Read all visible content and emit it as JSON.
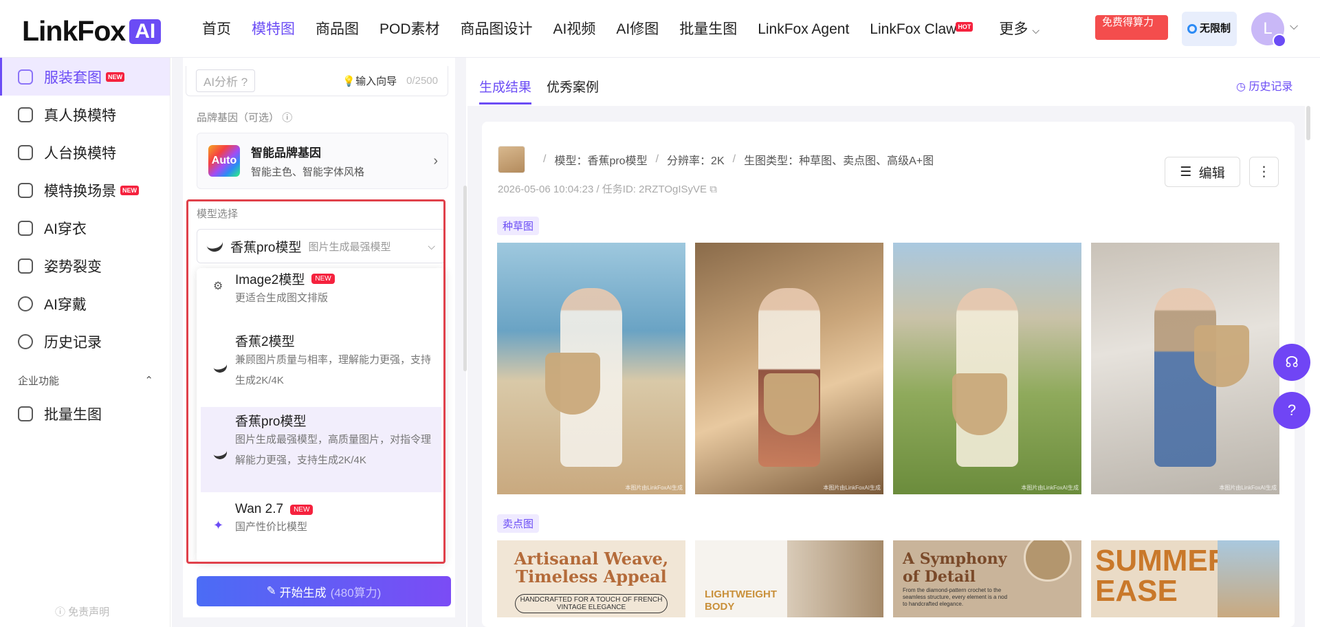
{
  "logo": {
    "text": "LinkFox",
    "badge": "AI"
  },
  "nav": {
    "items": [
      "首页",
      "模特图",
      "商品图",
      "POD素材",
      "商品图设计",
      "AI视频",
      "AI修图",
      "批量生图",
      "LinkFox Agent",
      "LinkFox Claw",
      "更多"
    ],
    "active": "模特图",
    "hot_label": "HOT"
  },
  "top_right": {
    "free_btn": "免费得算力",
    "unlimited_btn": "无限制",
    "avatar_letter": "L"
  },
  "sidebar": {
    "items": [
      {
        "label": "服装套图",
        "badge": "NEW",
        "active": true
      },
      {
        "label": "真人换模特"
      },
      {
        "label": "人台换模特"
      },
      {
        "label": "模特换场景",
        "badge": "NEW"
      },
      {
        "label": "AI穿衣"
      },
      {
        "label": "姿势裂变"
      },
      {
        "label": "AI穿戴"
      },
      {
        "label": "历史记录"
      }
    ],
    "section": "企业功能",
    "section_items": [
      {
        "label": "批量生图"
      }
    ],
    "disclaimer": "免责声明"
  },
  "panel": {
    "ai_chip": "AI分析",
    "guide": "输入向导",
    "count": "0/2500",
    "brand_label": "品牌基因（可选）",
    "brand_card": {
      "icon": "Auto",
      "title": "智能品牌基因",
      "subtitle": "智能主色、智能字体风格"
    },
    "model_label": "模型选择",
    "selected_model": {
      "name": "香蕉pro模型",
      "hint": "图片生成最强模型"
    },
    "options": [
      {
        "title": "Image2模型",
        "badge": "NEW",
        "desc": "更适合生成图文排版"
      },
      {
        "title": "香蕉2模型",
        "desc": "兼顾图片质量与相率，理解能力更强，支持生成2K/4K"
      },
      {
        "title": "香蕉pro模型",
        "desc": "图片生成最强模型，高质量图片，对指令理解能力更强，支持生成2K/4K",
        "selected": true
      },
      {
        "title": "Wan 2.7",
        "badge": "NEW",
        "desc": "国产性价比模型"
      }
    ],
    "generate": {
      "label": "开始生成",
      "cost": "(480算力)"
    }
  },
  "main": {
    "tabs": [
      "生成结果",
      "优秀案例"
    ],
    "active_tab": "生成结果",
    "history": "历史记录",
    "meta": {
      "model": "模型：香蕉pro模型",
      "resolution": "分辨率：2K",
      "type": "生图类型：种草图、卖点图、高级A+图"
    },
    "time": "2026-05-06 10:04:23 / 任务ID: 2RZTOgISyVE",
    "edit": "编辑",
    "section1": "种草图",
    "section2": "卖点图",
    "watermark": "本图片由LinkFoxAI生成",
    "promos": [
      {
        "title": "Artisanal Weave, Timeless Appeal",
        "sub": "HANDCRAFTED FOR A TOUCH OF FRENCH VINTAGE ELEGANCE"
      },
      {
        "title": "LIGHTWEIGHT BODY"
      },
      {
        "title": "A Symphony of Detail",
        "sub": "From the diamond-pattern crochet to the seamless structure, every element is a nod to handcrafted elegance."
      },
      {
        "title": "SUMMER EASE"
      }
    ]
  }
}
